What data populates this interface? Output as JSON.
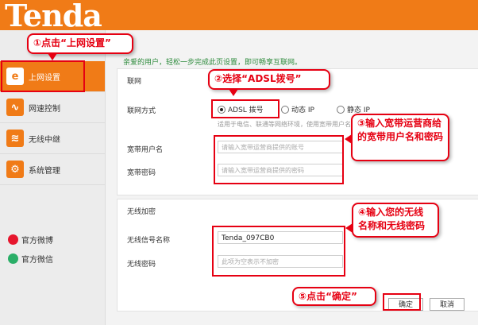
{
  "brand": "Tenda",
  "colors": {
    "accent": "#f07b17",
    "annotation": "#e60012",
    "intro_text": "#2d8b3c"
  },
  "sidebar": {
    "items": [
      {
        "label": "上网设置",
        "icon": "internet-explorer-icon",
        "active": true
      },
      {
        "label": "网速控制",
        "icon": "speed-wave-icon",
        "active": false
      },
      {
        "label": "无线中继",
        "icon": "wifi-signal-icon",
        "active": false
      },
      {
        "label": "系统管理",
        "icon": "gear-icon",
        "active": false
      }
    ],
    "social": [
      {
        "label": "官方微博",
        "icon": "weibo-icon"
      },
      {
        "label": "官方微信",
        "icon": "wechat-icon"
      }
    ]
  },
  "main": {
    "intro": "亲爱的用户，轻松一步完成此页设置，即可畅享互联网。",
    "internet_section": {
      "title": "联网",
      "method_label": "联网方式",
      "options": [
        {
          "label": "ADSL 拨号",
          "selected": true
        },
        {
          "label": "动态 IP",
          "selected": false
        },
        {
          "label": "静态 IP",
          "selected": false
        }
      ],
      "hint": "适用于电信、联通等网络环境，使用宽带用户名和密码上网的用户",
      "username_label": "宽带用户名",
      "username_placeholder": "请输入宽带运营商提供的账号",
      "password_label": "宽带密码",
      "password_placeholder": "请输入宽带运营商提供的密码"
    },
    "wireless_section": {
      "title": "无线加密",
      "ssid_label": "无线信号名称",
      "ssid_value": "Tenda_097CB0",
      "password_label": "无线密码",
      "password_placeholder": "此项为空表示不加密"
    },
    "buttons": {
      "ok": "确定",
      "cancel": "取消"
    }
  },
  "annotations": {
    "step1": "①点击“上网设置”",
    "step2": "②选择“ADSL拨号”",
    "step3": "③输入宽带运营商给的宽带用户名和密码",
    "step4": "④输入您的无线名称和无线密码",
    "step5": "⑤点击“确定”"
  }
}
